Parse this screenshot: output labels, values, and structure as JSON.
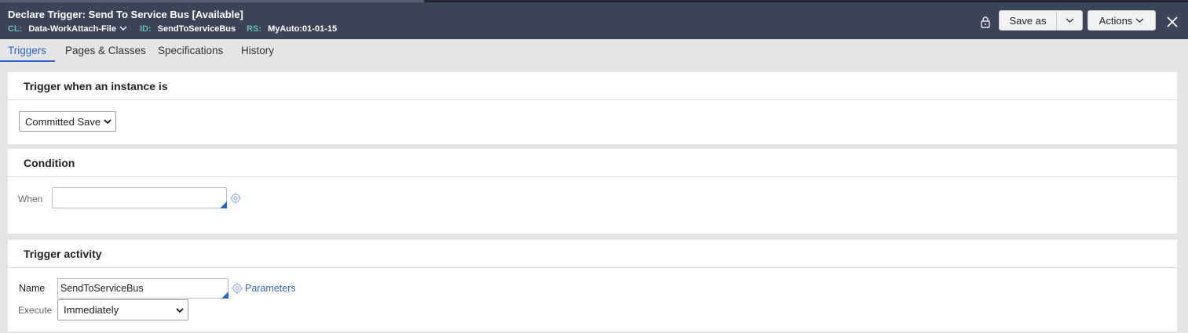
{
  "header": {
    "title": "Declare Trigger: Send To Service Bus [Available]",
    "cl_key": "CL:",
    "cl_value": "Data-WorkAttach-File",
    "id_key": "ID:",
    "id_value": "SendToServiceBus",
    "rs_key": "RS:",
    "rs_value": "MyAuto:01-01-15",
    "save_as_label": "Save as",
    "actions_label": "Actions",
    "lock_icon": "lock-icon",
    "close_icon": "close-icon"
  },
  "tabs": [
    {
      "label": "Triggers",
      "active": true
    },
    {
      "label": "Pages & Classes"
    },
    {
      "label": "Specifications"
    },
    {
      "label": "History"
    }
  ],
  "trigger_section": {
    "heading": "Trigger when an instance is",
    "selected": "Committed Save"
  },
  "condition_section": {
    "heading": "Condition",
    "when_label": "When",
    "when_value": ""
  },
  "activity_section": {
    "heading": "Trigger activity",
    "name_label": "Name",
    "name_value": "SendToServiceBus",
    "parameters_link": "Parameters",
    "execute_label": "Execute",
    "execute_selected": "Immediately"
  },
  "colors": {
    "header_bg": "#3e4458",
    "accent": "#2e62c6",
    "meta_key": "#5fbfb0"
  }
}
